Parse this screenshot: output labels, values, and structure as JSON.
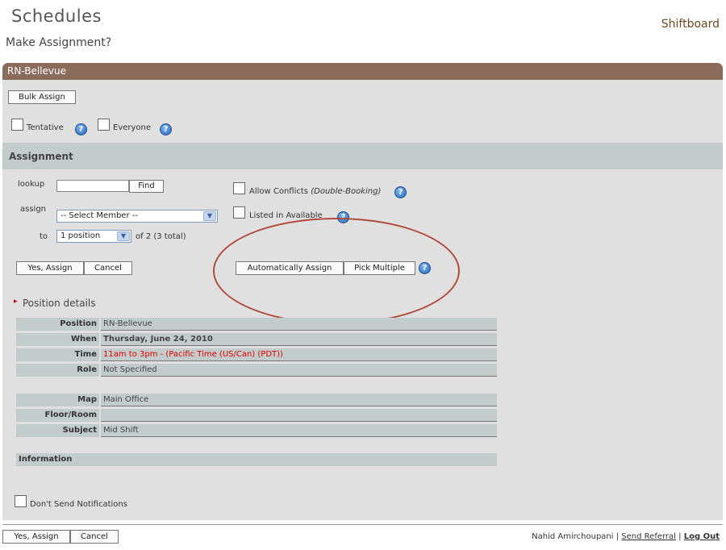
{
  "header": {
    "title": "Schedules",
    "subtitle": "Make Assignment?",
    "brand": "Shiftboard"
  },
  "section": {
    "title": "RN-Bellevue"
  },
  "toolbar": {
    "bulk_assign": "Bulk Assign"
  },
  "options": {
    "tentative": "Tentative",
    "everyone": "Everyone"
  },
  "assignment": {
    "heading": "Assignment",
    "lookup_label": "lookup",
    "lookup_value": "",
    "find_button": "Find",
    "assign_label": "assign",
    "member_select": "-- Select Member --",
    "to_label": "to",
    "position_select": "1 position",
    "of_text": "of 2 (3 total)",
    "allow_conflicts": "Allow Conflicts",
    "allow_conflicts_note": "(Double-Booking)",
    "listed_in_available": "Listed in Available",
    "yes_assign": "Yes, Assign",
    "cancel": "Cancel",
    "auto_assign": "Automatically Assign",
    "pick_multiple": "Pick Multiple"
  },
  "details": {
    "heading": "Position details",
    "rows_a": [
      {
        "key": "Position",
        "value": "RN-Bellevue"
      },
      {
        "key": "When",
        "value": "Thursday, June 24, 2010"
      },
      {
        "key": "Time",
        "value": "11am to 3pm - (Pacific Time (US/Can) (PDT))"
      },
      {
        "key": "Role",
        "value": "Not Specified"
      }
    ],
    "rows_b": [
      {
        "key": "Map",
        "value": "Main Office"
      },
      {
        "key": "Floor/Room",
        "value": ""
      },
      {
        "key": "Subject",
        "value": "Mid Shift"
      }
    ],
    "information": "Information"
  },
  "notifications": {
    "dont_send": "Don't Send Notifications"
  },
  "footer": {
    "yes_assign": "Yes, Assign",
    "cancel": "Cancel",
    "user": "Nahid Amirchoupani",
    "separator": "|",
    "send_referral": "Send Referral",
    "log_out": "Log Out"
  },
  "icons": {
    "help": "?",
    "dropdown": "▼",
    "bullet": "▸"
  },
  "colors": {
    "section_bar": "#8b6c5c",
    "assign_bar": "#c3cbcb",
    "time_value": "#e00000",
    "annotation": "#b04a3a"
  }
}
